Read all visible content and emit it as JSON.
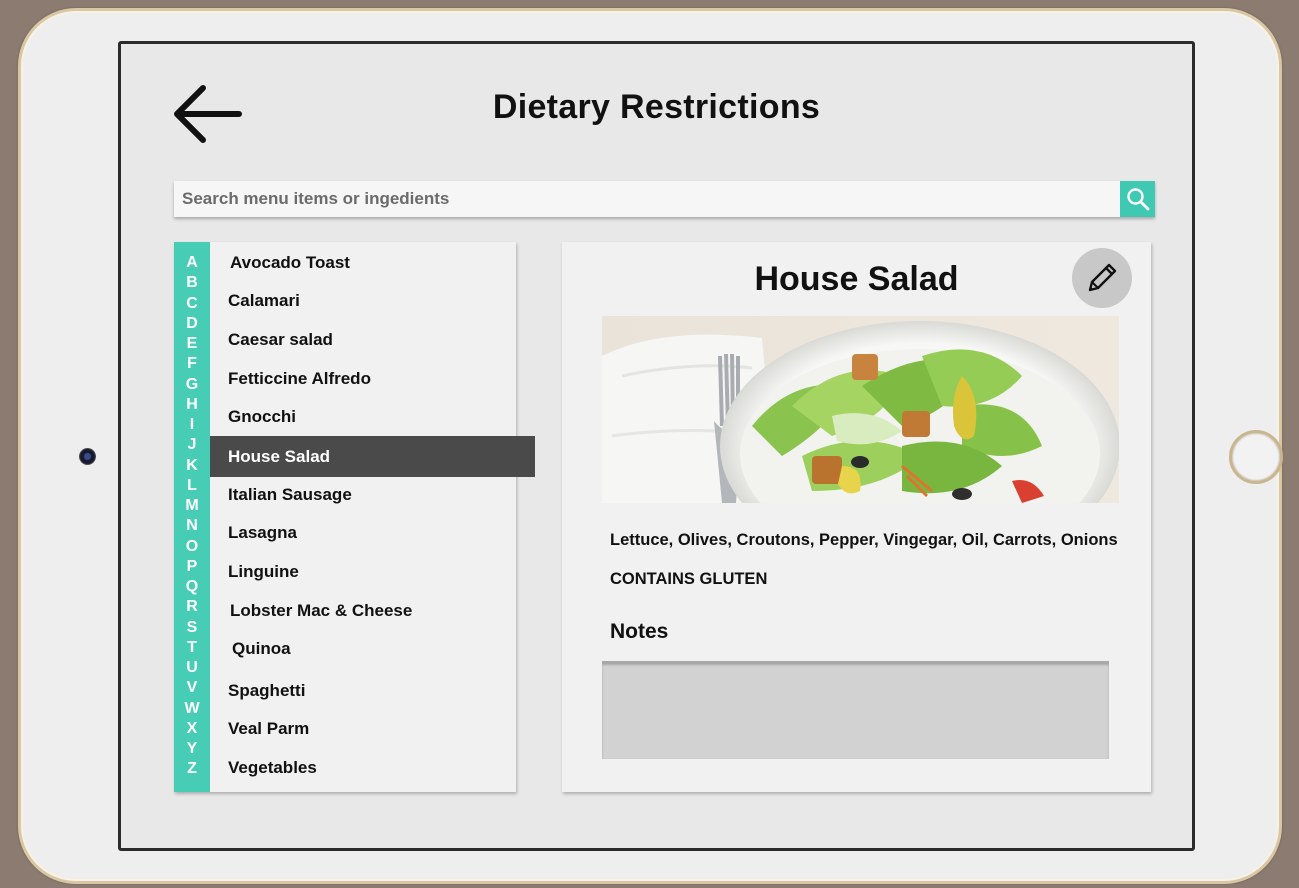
{
  "header": {
    "title": "Dietary Restrictions",
    "back_icon": "arrow-left-icon"
  },
  "search": {
    "placeholder": "Search menu items or ingedients",
    "value": "",
    "icon": "search-icon",
    "accent_color": "#3fc8b2"
  },
  "alphabet": [
    "A",
    "B",
    "C",
    "D",
    "E",
    "F",
    "G",
    "H",
    "I",
    "J",
    "K",
    "L",
    "M",
    "N",
    "O",
    "P",
    "Q",
    "R",
    "S",
    "T",
    "U",
    "V",
    "W",
    "X",
    "Y",
    "Z"
  ],
  "menu_items": [
    {
      "label": "Avocado Toast",
      "selected": false
    },
    {
      "label": "Calamari",
      "selected": false
    },
    {
      "label": "Caesar salad",
      "selected": false
    },
    {
      "label": "Fetticcine Alfredo",
      "selected": false
    },
    {
      "label": "Gnocchi",
      "selected": false
    },
    {
      "label": "House Salad",
      "selected": true
    },
    {
      "label": "Italian Sausage",
      "selected": false
    },
    {
      "label": "Lasagna",
      "selected": false
    },
    {
      "label": "Linguine",
      "selected": false
    },
    {
      "label": "Lobster Mac & Cheese",
      "selected": false
    },
    {
      "label": "Quinoa",
      "selected": false
    },
    {
      "label": "Spaghetti",
      "selected": false
    },
    {
      "label": "Veal Parm",
      "selected": false
    },
    {
      "label": "Vegetables",
      "selected": false
    }
  ],
  "detail": {
    "title": "House Salad",
    "edit_icon": "pencil-icon",
    "ingredients": "Lettuce, Olives, Croutons, Pepper, Vingegar, Oil, Carrots, Onions",
    "allergen": "CONTAINS GLUTEN",
    "notes_label": "Notes",
    "notes_value": ""
  },
  "colors": {
    "accent": "#47cdb6",
    "selected_row": "#4a4a4a",
    "notes_field": "#d2d2d2"
  }
}
